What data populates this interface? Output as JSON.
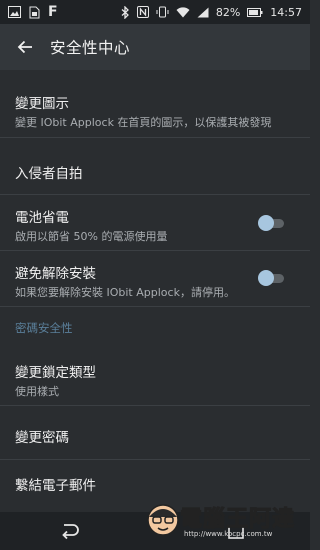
{
  "status_bar": {
    "left_icons": [
      "photo-icon",
      "sim-icon",
      "facebook-icon"
    ],
    "f_glyph": "F",
    "right_icons": [
      "bluetooth-icon",
      "nfc-icon",
      "vibrate-icon",
      "wifi-icon",
      "signal-icon",
      "battery-icon"
    ],
    "battery": "82%",
    "time": "14:57"
  },
  "toolbar": {
    "title": "安全性中心"
  },
  "items": {
    "change_icon": {
      "title": "變更圖示",
      "subtitle": "變更 IObit Applock 在首頁的圖示，以保護其被發現"
    },
    "intruder": {
      "title": "入侵者自拍"
    },
    "battery_saver": {
      "title": "電池省電",
      "subtitle": "啟用以節省 50% 的電源使用量",
      "enabled": true
    },
    "prevent_uninstall": {
      "title": "避免解除安裝",
      "subtitle": "如果您要解除安裝 IObit Applock，請停用。",
      "enabled": true
    },
    "section_password": "密碼安全性",
    "lock_type": {
      "title": "變更鎖定類型",
      "subtitle": "使用樣式"
    },
    "change_password": {
      "title": "變更密碼"
    },
    "link_email": {
      "title": "繫結電子郵件"
    }
  },
  "watermark": {
    "text": "電腦王阿達",
    "url": "http://www.kocpc.com.tw"
  },
  "colors": {
    "toolbar": "#33373b",
    "background": "#2a2d30",
    "accent": "#a7c6df",
    "section": "#5a7f9a"
  }
}
